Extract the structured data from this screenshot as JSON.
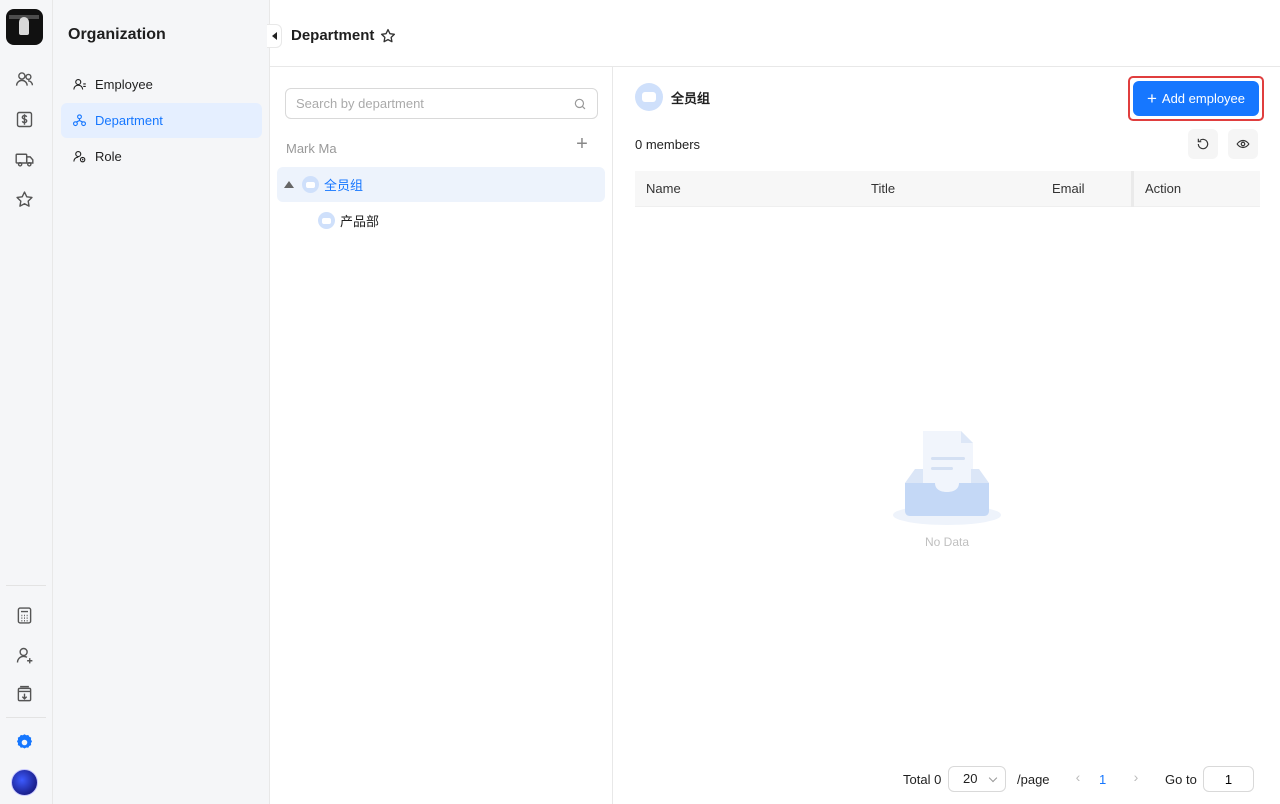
{
  "rail": {
    "items": [
      "contacts-icon",
      "billing-icon",
      "delivery-icon",
      "favorites-icon"
    ],
    "bottom_items": [
      "calculator-icon",
      "user-add-icon",
      "export-icon",
      "settings-icon"
    ],
    "accent": "#1677ff"
  },
  "subnav": {
    "title": "Organization",
    "items": [
      {
        "label": "Employee",
        "icon": "employee-icon"
      },
      {
        "label": "Department",
        "icon": "department-icon",
        "active": true
      },
      {
        "label": "Role",
        "icon": "role-icon"
      }
    ]
  },
  "header": {
    "title": "Department"
  },
  "tree": {
    "search_placeholder": "Search by department",
    "org_name": "Mark Ma",
    "nodes": [
      {
        "label": "全员组",
        "selected": true
      },
      {
        "label": "产品部"
      }
    ]
  },
  "main": {
    "dept_name": "全员组",
    "add_label": "Add employee",
    "members": "0 members",
    "columns": [
      "Name",
      "Title",
      "Email",
      "Action"
    ],
    "empty_text": "No Data",
    "pagination": {
      "total": "Total 0",
      "page_size": "20",
      "per_page": "/page",
      "current_page": "1",
      "goto_label": "Go to",
      "goto_value": "1"
    }
  }
}
